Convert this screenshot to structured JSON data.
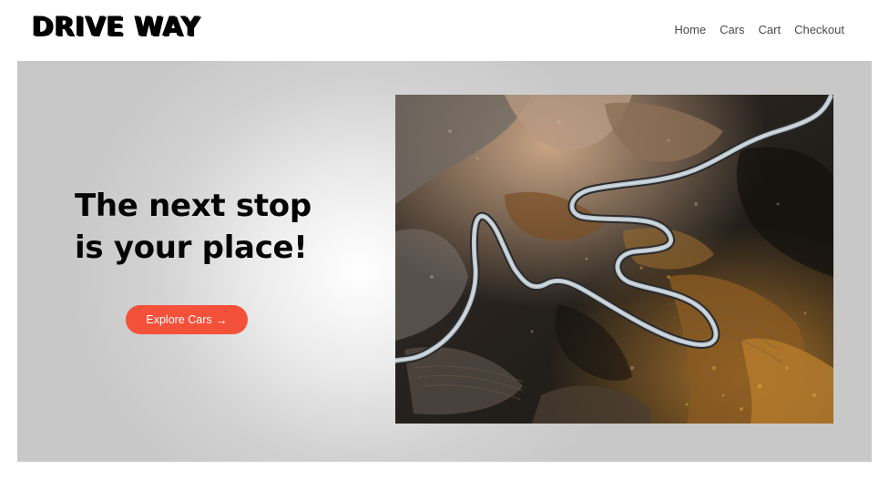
{
  "header": {
    "logo": "DRIVE WAY",
    "nav": [
      "Home",
      "Cars",
      "Cart",
      "Checkout"
    ]
  },
  "hero": {
    "headline_line1": "The next stop",
    "headline_line2": "is your place!",
    "cta_label": "Explore Cars",
    "cta_arrow": "→",
    "image_subject": "aerial view of a winding mountain road",
    "colors": {
      "cta": "#f4513a",
      "background_center": "#ffffff",
      "background_edge": "#c8c8c8"
    }
  }
}
